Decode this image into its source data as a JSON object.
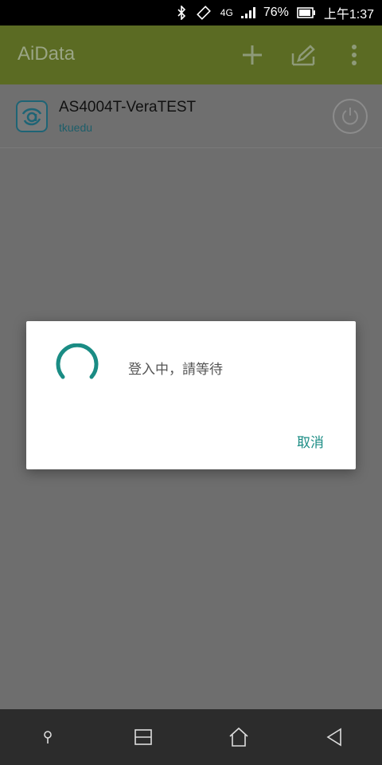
{
  "status_bar": {
    "network": "4G",
    "battery": "76%",
    "time": "上午1:37",
    "icons": [
      "bluetooth-icon",
      "vibrate-icon",
      "network-icon",
      "signal-icon",
      "battery-icon"
    ]
  },
  "app_bar": {
    "title": "AiData",
    "actions": [
      "add-icon",
      "edit-icon",
      "more-icon"
    ]
  },
  "device_list": {
    "items": [
      {
        "name": "AS4004T-VeraTEST",
        "subtitle": "tkuedu",
        "icon": "power-icon"
      }
    ]
  },
  "dialog": {
    "message": "登入中，請等待",
    "cancel_label": "取消"
  },
  "nav_bar": {
    "buttons": [
      "pin-icon",
      "recent-apps-icon",
      "home-icon",
      "back-icon"
    ]
  },
  "colors": {
    "app_bar": "#5b6b23",
    "accent": "#1a8c84",
    "overlay": "#6e6e6e"
  }
}
